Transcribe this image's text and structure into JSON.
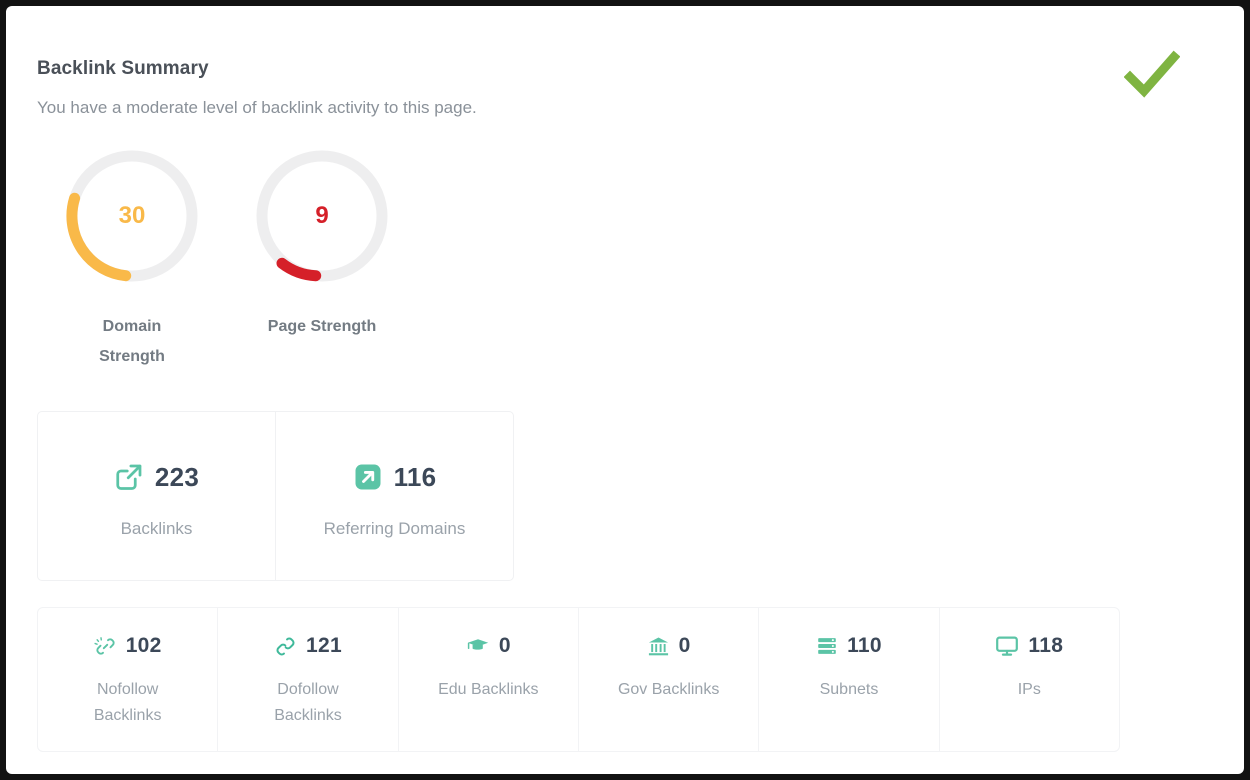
{
  "header": {
    "title": "Backlink Summary",
    "subtitle": "You have a moderate level of backlink activity to this page.",
    "status_icon": "check-icon",
    "status_color": "#7fb441"
  },
  "gauges": [
    {
      "value": "30",
      "percent": 30,
      "label": "Domain Strength",
      "color": "#f9b949",
      "track_color": "#eeeeef",
      "icon": "donut-gauge"
    },
    {
      "value": "9",
      "percent": 9,
      "label": "Page Strength",
      "color": "#d52029",
      "track_color": "#eeeeef",
      "icon": "donut-gauge"
    }
  ],
  "primary_stats": [
    {
      "value": "223",
      "label": "Backlinks",
      "icon": "external-link-icon",
      "color": "#5bc4a6"
    },
    {
      "value": "116",
      "label": "Referring Domains",
      "icon": "arrow-up-right-filled-icon",
      "color": "#5bc4a6"
    }
  ],
  "secondary_stats": [
    {
      "value": "102",
      "label": "Nofollow Backlinks",
      "icon": "broken-link-icon",
      "color": "#5bc4a6"
    },
    {
      "value": "121",
      "label": "Dofollow Backlinks",
      "icon": "link-icon",
      "color": "#3fb99a"
    },
    {
      "value": "0",
      "label": "Edu Backlinks",
      "icon": "graduation-cap-icon",
      "color": "#5bc4a6"
    },
    {
      "value": "0",
      "label": "Gov Backlinks",
      "icon": "bank-icon",
      "color": "#5bc4a6"
    },
    {
      "value": "110",
      "label": "Subnets",
      "icon": "server-icon",
      "color": "#5bc4a6"
    },
    {
      "value": "118",
      "label": "IPs",
      "icon": "monitor-icon",
      "color": "#5bc4a6"
    }
  ]
}
